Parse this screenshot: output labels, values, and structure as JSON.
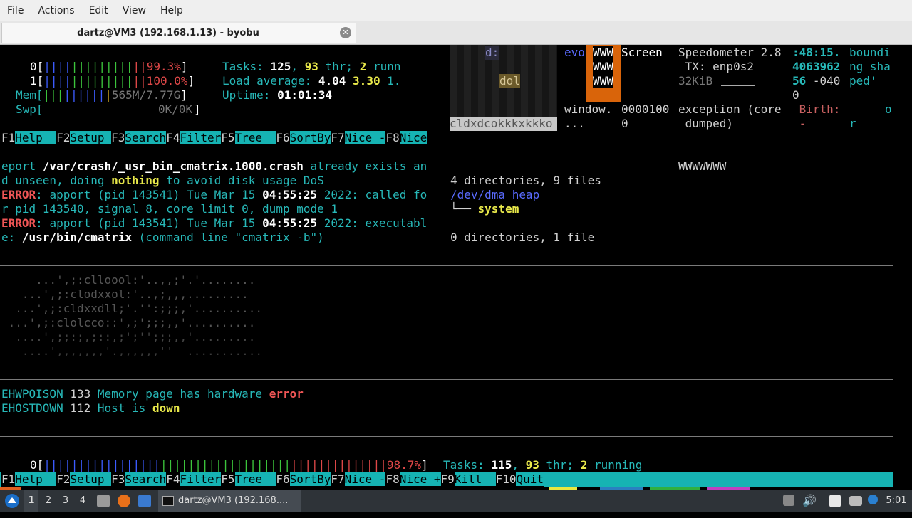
{
  "menubar": {
    "items": [
      "File",
      "Actions",
      "Edit",
      "View",
      "Help"
    ]
  },
  "tab": {
    "title": "dartz@VM3 (192.168.1.13) - byobu"
  },
  "htop_top": {
    "cpu0_label": "0[",
    "cpu0_bars_blue": "||||",
    "cpu0_bars_green": "|||||||||",
    "cpu0_bars_red": "||",
    "cpu0_pct": "99.3%",
    "cpu0_end": "]",
    "cpu1_label": "1[",
    "cpu1_bars_blue": "||||",
    "cpu1_bars_green": "|||||||||",
    "cpu1_bars_red": "||",
    "cpu1_pct": "100.0%",
    "cpu1_end": "]",
    "mem_label": "Mem[",
    "mem_bars_green": "|||",
    "mem_bars_blue": "||||||",
    "mem_bars_y": "|",
    "mem_val": "565M/7.77G",
    "mem_end": "]",
    "swp_label": "Swp[",
    "swp_val": "0K/0K",
    "swp_end": "]",
    "tasks_label": "Tasks:",
    "tasks_count": "125",
    "thr_count": "93",
    "thr_label": "thr;",
    "run_count": "2",
    "run_label": "runn",
    "load_label": "Load average:",
    "load1": "4.04",
    "load5": "3.30",
    "load15": "1.",
    "uptime_label": "Uptime:",
    "uptime": "01:01:34"
  },
  "fkeys_top": [
    {
      "num": "F1",
      "label": "Help  "
    },
    {
      "num": "F2",
      "label": "Setup "
    },
    {
      "num": "F3",
      "label": "Search"
    },
    {
      "num": "F4",
      "label": "Filter"
    },
    {
      "num": "F5",
      "label": "Tree  "
    },
    {
      "num": "F6",
      "label": "SortBy"
    },
    {
      "num": "F7",
      "label": "Nice -"
    },
    {
      "num": "F8",
      "label": "Nice"
    }
  ],
  "matrix_box": {
    "text1": "d:",
    "text2": "dol",
    "bottom": "cldxdcokkkxkkko"
  },
  "top_panes": {
    "evo": "evo",
    "www": [
      "WWW",
      "WWW",
      "WWW"
    ],
    "screen": "Screen",
    "speedo_line1": "Speedometer 2.8",
    "speedo_line2": " TX: enp0s2",
    "speedo_line3": "32KiB",
    "time_line1": ":48:15.",
    "time_line2": "4063962",
    "time_line3a": "56",
    "time_line3b": " -040",
    "time_line4": "0",
    "bound_line1": "boundi",
    "bound_line2": "ng_sha",
    "bound_line3": "ped'",
    "window_line1": "window.",
    "window_line2": "...",
    "num_line1": "0000100",
    "num_line2": "0",
    "exc_line1": "exception (core",
    "exc_line2": " dumped)",
    "birth_line1": " Birth:",
    "birth_line2": " -",
    "o_line1": "o",
    "o_line2": "r"
  },
  "apport": {
    "l1a": "eport ",
    "l1b": "/var/crash/_usr_bin_cmatrix.1000.crash",
    "l1c": " already exists an",
    "l2a": "d unseen, doing ",
    "l2b": "nothing",
    "l2c": " to avoid disk usage DoS",
    "l3a": "ERROR",
    "l3b": ": apport (pid 143541) Tue Mar 15 ",
    "l3c": "04:55:25",
    "l3d": " 2022: called fo",
    "l4": "r pid 143540, signal 8, core limit 0, dump mode 1",
    "l5a": "ERROR",
    "l5b": ": apport (pid 143541) Tue Mar 15 ",
    "l5c": "04:55:25",
    "l5d": " 2022: executabl",
    "l6a": "e: ",
    "l6b": "/usr/bin/cmatrix",
    "l6c": " (command line \"cmatrix -b\")"
  },
  "tree": {
    "summary1": "4 directories, 9 files",
    "dir": "/dev/dma_heap",
    "branch": "└── ",
    "child": "system",
    "summary2": "0 directories, 1 file"
  },
  "wpane": {
    "text": "WWWWWWW"
  },
  "ascii_art": [
    "     ...',;:clloool:'..,,;'.'........",
    "   ...',;:clodxxol:'..,;,,,.........",
    "  ...',;:cldxxdll;'.'':;;;,'..........",
    " ...',;:clolcco::',;';;;,,'..........",
    "  ....',;;:;,;::,;';'';;;,,'.........",
    "   ....',,,,,,,'.,,,,,,''  ..........."
  ],
  "errno": {
    "l1a": "EHWPOISON",
    "l1b": " 133 ",
    "l1c": "Memory page has hardware ",
    "l1d": "error",
    "l2a": "EHOSTDOWN",
    "l2b": " 112 ",
    "l2c": "Host is ",
    "l2d": "down"
  },
  "htop_bottom": {
    "cpu0_label": "0[",
    "cpu0_bars_blue": "|||||||||||||||||",
    "cpu0_bars_green": "|||||||||||||||||||",
    "cpu0_bars_red": "||||||||||||||",
    "cpu0_pct": "98.7%",
    "cpu0_end": "]",
    "tasks_label": "Tasks:",
    "tasks_count": "115",
    "thr_count": "93",
    "thr_label": "thr;",
    "run_count": "2",
    "run_label": "running"
  },
  "fkeys_bottom": [
    {
      "num": "F1",
      "label": "Help  "
    },
    {
      "num": "F2",
      "label": "Setup "
    },
    {
      "num": "F3",
      "label": "Search"
    },
    {
      "num": "F4",
      "label": "Filter"
    },
    {
      "num": "F5",
      "label": "Tree  "
    },
    {
      "num": "F6",
      "label": "SortBy"
    },
    {
      "num": "F7",
      "label": "Nice -"
    },
    {
      "num": "F8",
      "label": "Nice +"
    },
    {
      "num": "F9",
      "label": "Kill  "
    },
    {
      "num": "F10",
      "label": "Quit"
    }
  ],
  "taskbar": {
    "workspaces": [
      "1",
      "2",
      "3",
      "4"
    ],
    "window_label": "dartz@VM3 (192.168....",
    "clock": "5:01"
  },
  "colors": {
    "accent_cyan": "#16b3b3",
    "orange": "#d9640a",
    "taskbar": "#2e3338"
  }
}
